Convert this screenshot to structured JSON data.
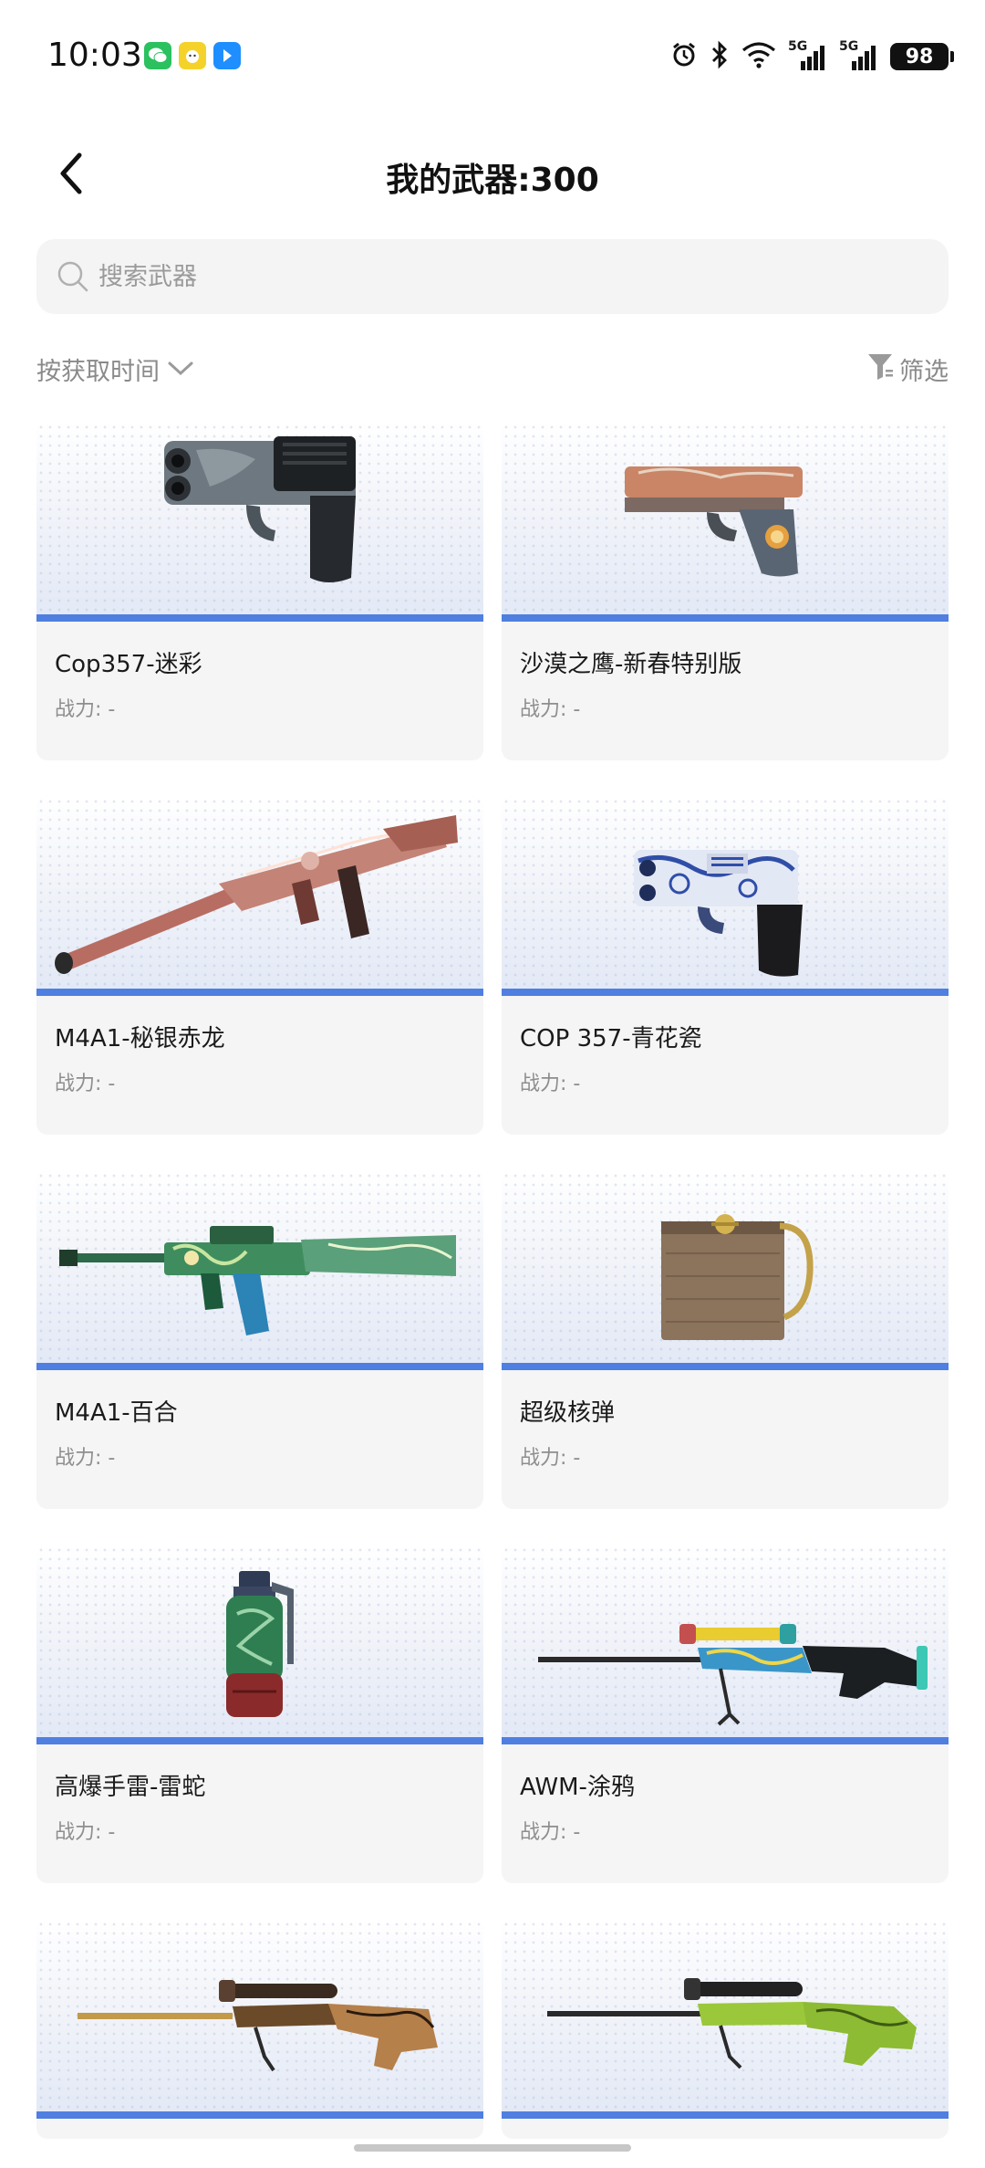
{
  "status_bar": {
    "time": "10:03",
    "battery": "98",
    "signal_1_label": "5G",
    "signal_2_label": "5G",
    "apps": [
      "wechat-icon",
      "app-badge-icon",
      "direction-app-icon"
    ]
  },
  "header": {
    "title": "我的武器:300"
  },
  "search": {
    "placeholder": "搜索武器",
    "value": ""
  },
  "sort": {
    "label": "按获取时间"
  },
  "filter": {
    "label": "筛选"
  },
  "weapons": [
    {
      "name": "Cop357-迷彩",
      "power": "战力: -"
    },
    {
      "name": "沙漠之鹰-新春特别版",
      "power": "战力: -"
    },
    {
      "name": "M4A1-秘银赤龙",
      "power": "战力: -"
    },
    {
      "name": "COP 357-青花瓷",
      "power": "战力: -"
    },
    {
      "name": "M4A1-百合",
      "power": "战力: -"
    },
    {
      "name": "超级核弹",
      "power": "战力: -"
    },
    {
      "name": "高爆手雷-雷蛇",
      "power": "战力: -"
    },
    {
      "name": "AWM-涂鸦",
      "power": "战力: -"
    }
  ],
  "colors": {
    "accent_bar": "#4f7fe0",
    "card_bg": "#f5f5f6",
    "muted_text": "#8e8e8e"
  }
}
